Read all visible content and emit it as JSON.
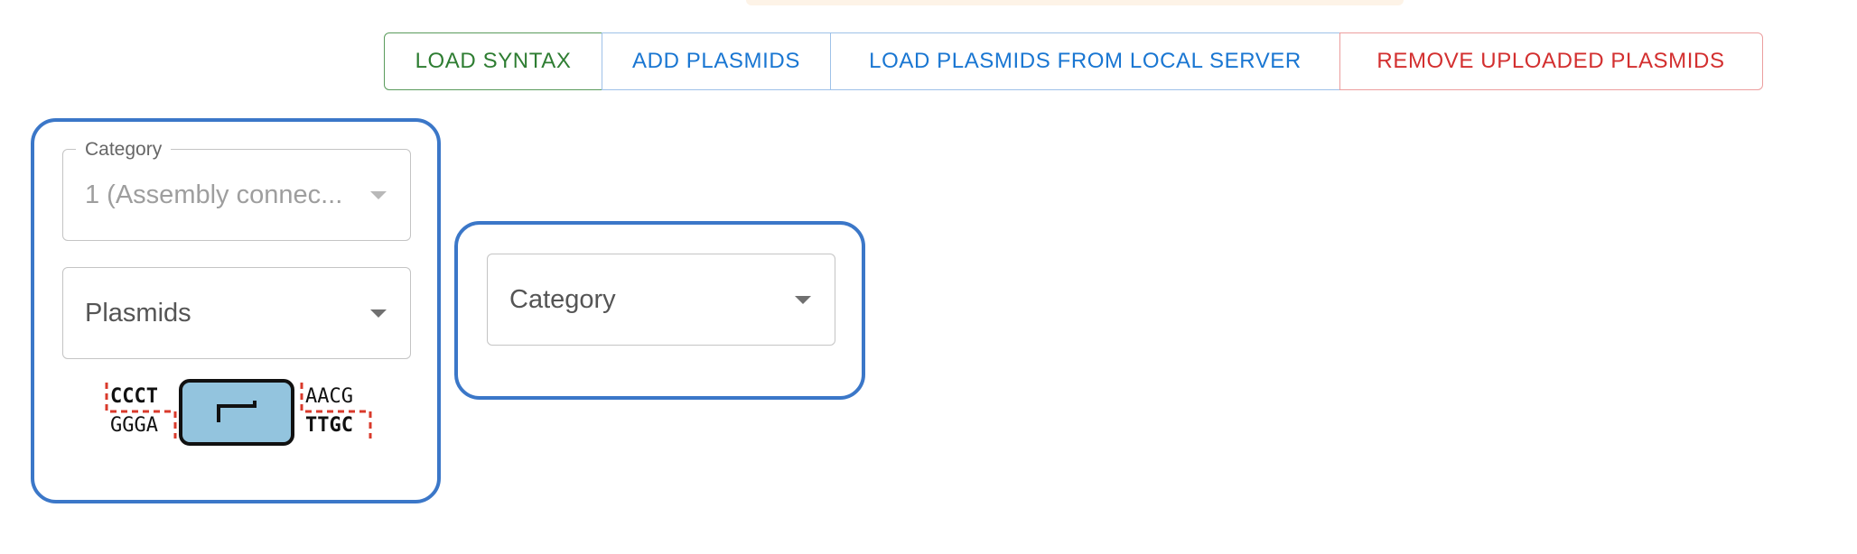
{
  "toolbar": {
    "load_syntax": "LOAD SYNTAX",
    "add_plasmids": "ADD PLASMIDS",
    "load_local": "LOAD PLASMIDS FROM LOCAL SERVER",
    "remove_uploaded": "REMOVE UPLOADED PLASMIDS"
  },
  "card1": {
    "category_label": "Category",
    "category_value": "1 (Assembly connec...",
    "plasmids_placeholder": "Plasmids",
    "part_glyph": {
      "icon": "promoter-icon",
      "left_top": "CCCT",
      "left_bottom": "GGGA",
      "right_top": "AACG",
      "right_bottom": "TTGC"
    }
  },
  "card2": {
    "category_placeholder": "Category"
  },
  "colors": {
    "card_border": "#3b77c8",
    "green": "#2e7d32",
    "blue": "#1976d2",
    "red": "#d32f2f",
    "glyph_fill": "#93c4de",
    "overhang_dash": "#d93a2b"
  }
}
